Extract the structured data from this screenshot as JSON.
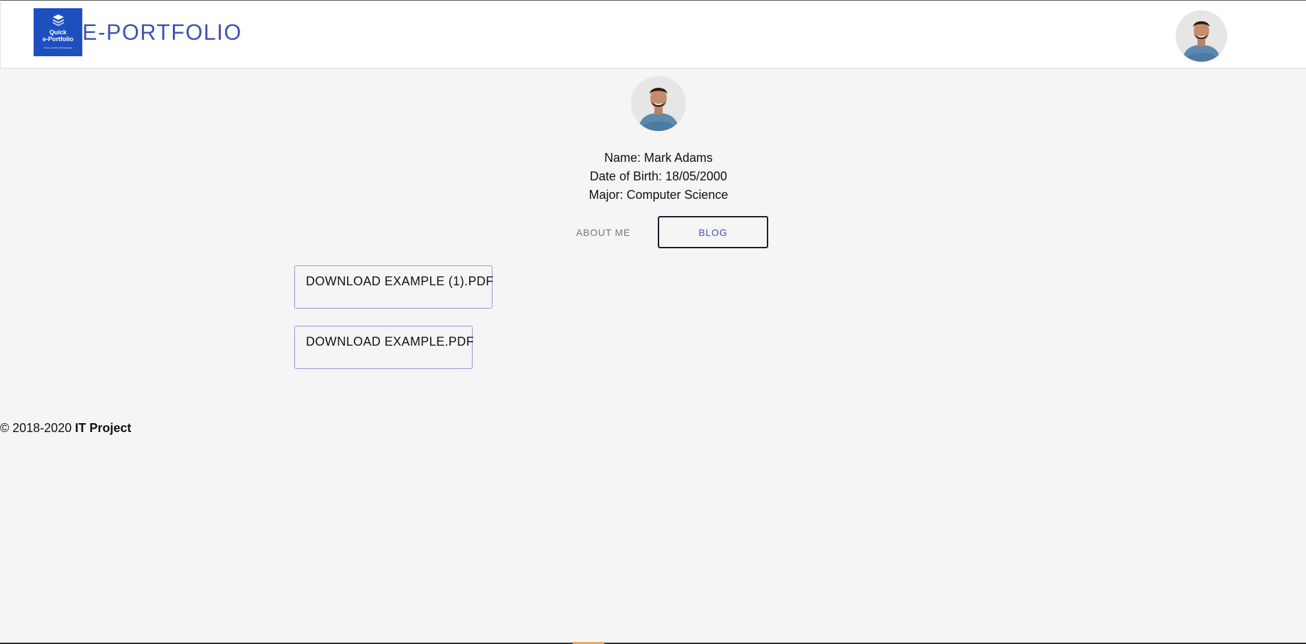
{
  "header": {
    "logo": {
      "line1": "Quick",
      "line2": "e-Portfolio",
      "tagline": "Your Career Showcase",
      "color": "#1e4fbf"
    },
    "brand_title": "E-PORTFOLIO",
    "brand_color": "#3f51b5",
    "avatar_icon": "user-avatar"
  },
  "profile": {
    "avatar_icon": "user-avatar",
    "name_line": "Name: Mark Adams",
    "dob_line": "Date of Birth: 18/05/2000",
    "major_line": "Major: Computer Science"
  },
  "tabs": [
    {
      "label": "ABOUT ME",
      "active": false
    },
    {
      "label": "BLOG",
      "active": true
    }
  ],
  "downloads": [
    {
      "label": "DOWNLOAD EXAMPLE (1).PDF"
    },
    {
      "label": "DOWNLOAD EXAMPLE.PDF"
    }
  ],
  "footer": {
    "copyright": "© 2018-2020 ",
    "project": "IT Project"
  }
}
